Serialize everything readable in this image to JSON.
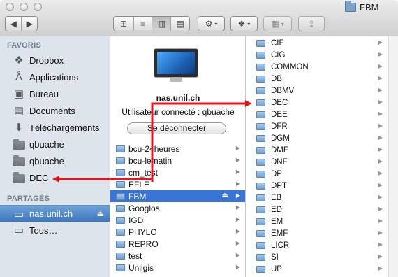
{
  "window": {
    "title": "FBM"
  },
  "toolbar": {
    "view_icons": "⊞",
    "view_list": "≡",
    "view_columns": "▥",
    "view_coverflow": "▤",
    "action": "⚙",
    "dropbox": "❖",
    "arrange": "▦",
    "share": "⇪",
    "caret": "▾"
  },
  "sidebar": {
    "favorites_header": "FAVORIS",
    "favorites": [
      {
        "label": "Dropbox",
        "icon": "dropbox-icon"
      },
      {
        "label": "Applications",
        "icon": "applications-icon"
      },
      {
        "label": "Bureau",
        "icon": "desktop-icon"
      },
      {
        "label": "Documents",
        "icon": "documents-icon"
      },
      {
        "label": "Téléchargements",
        "icon": "downloads-icon"
      },
      {
        "label": "qbuache",
        "icon": "folder-icon"
      },
      {
        "label": "qbuache",
        "icon": "folder-icon"
      },
      {
        "label": "DEC",
        "icon": "folder-icon"
      }
    ],
    "shared_header": "PARTAGÉS",
    "shared": [
      {
        "label": "nas.unil.ch",
        "icon": "server-icon",
        "selected": true
      },
      {
        "label": "Tous…",
        "icon": "network-icon"
      }
    ]
  },
  "server": {
    "name": "nas.unil.ch",
    "user_text": "Utilisateur connecté : qbuache",
    "disconnect_label": "Se déconnecter"
  },
  "column1": {
    "items": [
      "bcu-24heures",
      "bcu-lematin",
      "cm_test",
      "EFLE",
      "FBM",
      "Googlos",
      "IGD",
      "PHYLO",
      "REPRO",
      "test",
      "Unilgis"
    ],
    "selected": "FBM"
  },
  "column2": {
    "items": [
      "CIF",
      "CIG",
      "COMMON",
      "DB",
      "DBMV",
      "DEC",
      "DEE",
      "DFR",
      "DGM",
      "DMF",
      "DNF",
      "DP",
      "DPT",
      "EB",
      "ED",
      "EM",
      "EMF",
      "LICR",
      "SI",
      "UP"
    ]
  },
  "colors": {
    "annotation_arrow": "#e8141b",
    "selection": "#3875d7"
  }
}
